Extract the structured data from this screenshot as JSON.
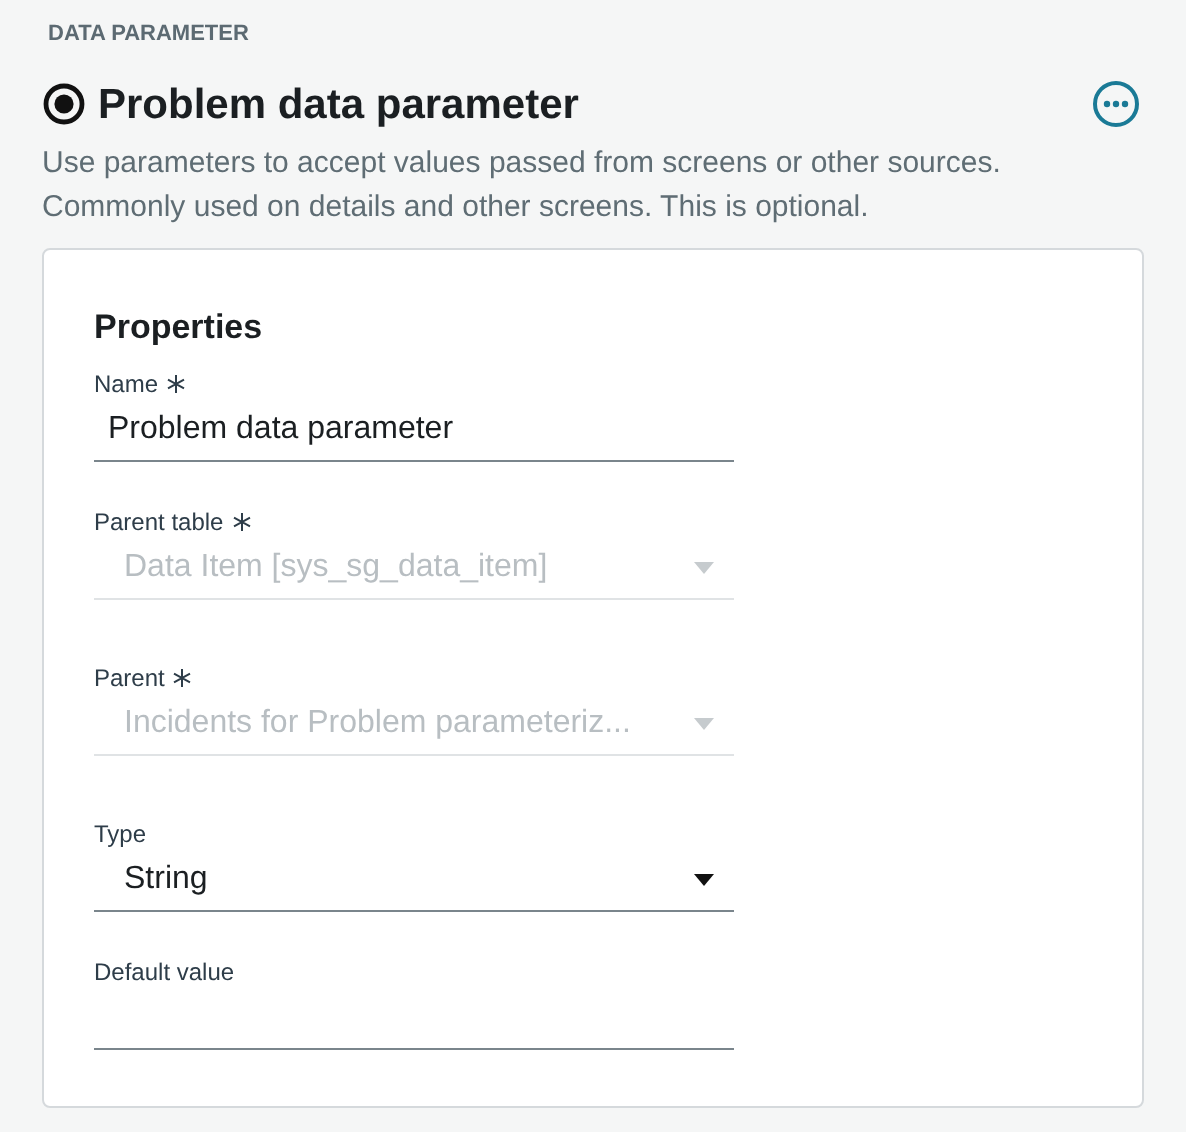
{
  "section_label": "DATA PARAMETER",
  "title": "Problem data parameter",
  "description": "Use parameters to accept values passed from screens or other sources. Commonly used on details and other screens. This is optional.",
  "card": {
    "heading": "Properties",
    "fields": [
      {
        "kind": "text",
        "label": "Name",
        "required": true,
        "disabled": false,
        "value": "Problem data parameter"
      },
      {
        "kind": "select",
        "label": "Parent table",
        "required": true,
        "disabled": true,
        "value": "Data Item [sys_sg_data_item]"
      },
      {
        "kind": "select",
        "label": "Parent",
        "required": true,
        "disabled": true,
        "value": "Incidents for Problem parameteriz..."
      },
      {
        "kind": "select",
        "label": "Type",
        "required": false,
        "disabled": false,
        "value": "String"
      },
      {
        "kind": "text",
        "label": "Default value",
        "required": false,
        "disabled": false
      }
    ]
  }
}
